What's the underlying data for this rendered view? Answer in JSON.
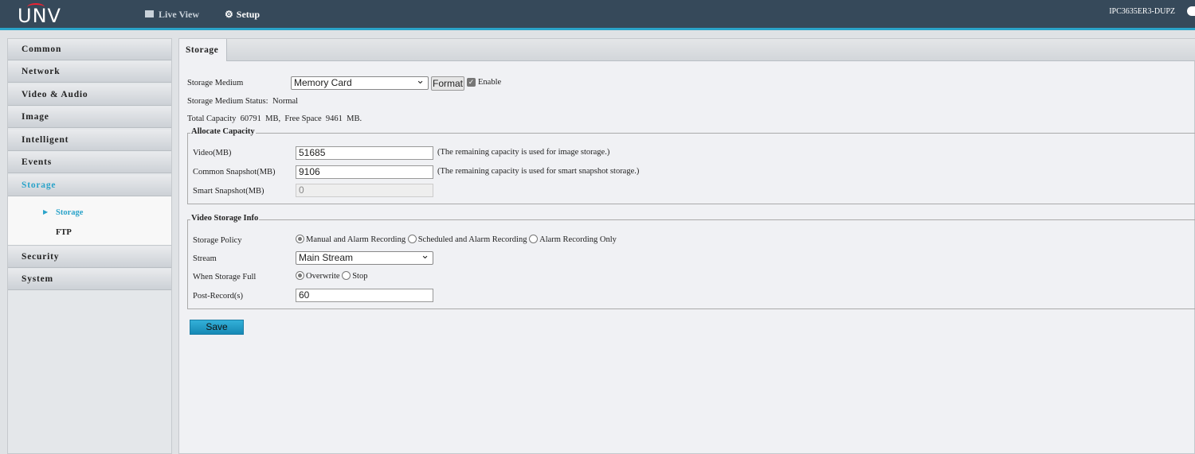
{
  "header": {
    "logo": "UNV",
    "nav": [
      {
        "label": "Live View",
        "icon": "monitor-icon"
      },
      {
        "label": "Setup",
        "icon": "gear-icon"
      }
    ],
    "model": "IPC3635ER3-DUPZ"
  },
  "sidebar": {
    "items": [
      "Common",
      "Network",
      "Video & Audio",
      "Image",
      "Intelligent",
      "Events",
      "Storage",
      "Security",
      "System"
    ],
    "active": "Storage",
    "sub_items": [
      "Storage",
      "FTP"
    ]
  },
  "tab": "Storage",
  "form": {
    "storage_medium_label": "Storage Medium",
    "storage_medium_value": "Memory Card",
    "format_label": "Format",
    "enable_label": "Enable",
    "enable_checked": true,
    "status_label": "Storage Medium Status:",
    "status_value": "Normal",
    "capacity_text": "Total Capacity  60791  MB,  Free Space  9461  MB.",
    "allocate": {
      "legend": "Allocate Capacity",
      "video_label": "Video(MB)",
      "video_value": "51685",
      "video_hint": "(The remaining capacity is used for image storage.)",
      "common_label": "Common Snapshot(MB)",
      "common_value": "9106",
      "common_hint": "(The remaining capacity is used for smart snapshot storage.)",
      "smart_label": "Smart Snapshot(MB)",
      "smart_value": "0"
    },
    "video_info": {
      "legend": "Video Storage Info",
      "policy_label": "Storage Policy",
      "policy_options": [
        "Manual and Alarm Recording",
        "Scheduled and Alarm Recording",
        "Alarm Recording Only"
      ],
      "policy_selected": "Manual and Alarm Recording",
      "stream_label": "Stream",
      "stream_value": "Main Stream",
      "full_label": "When Storage Full",
      "full_options": [
        "Overwrite",
        "Stop"
      ],
      "full_selected": "Overwrite",
      "post_label": "Post-Record(s)",
      "post_value": "60"
    },
    "save_label": "Save"
  },
  "colors": {
    "header": "#36495a",
    "accent": "#2aa3c9"
  }
}
